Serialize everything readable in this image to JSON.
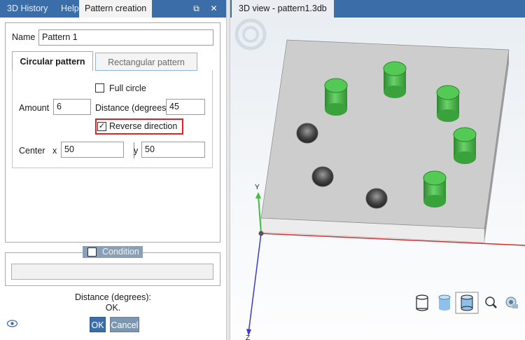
{
  "left_panel": {
    "tabs": [
      "3D History",
      "Help",
      "Pattern creation"
    ],
    "active_tab": "Pattern creation",
    "controls": {
      "pin": "⧉",
      "close": "✕"
    },
    "name_label": "Name",
    "name_value": "Pattern 1",
    "pattern_tabs": [
      "Circular pattern",
      "Rectangular pattern"
    ],
    "full_circle_label": "Full circle",
    "full_circle_checked": false,
    "amount_label": "Amount",
    "amount_value": "6",
    "distance_label": "Distance (degrees)",
    "distance_value": "45",
    "reverse_label": "Reverse direction",
    "reverse_checked": true,
    "center_label": "Center",
    "x_label": "x",
    "x_value": "50",
    "y_label": "y",
    "y_value": "50",
    "condition_label": "Condition",
    "condition_checked": false,
    "status_line1": "Distance (degrees):",
    "status_line2": "OK.",
    "ok_label": "OK",
    "cancel_label": "Cancel",
    "visibility_icon": "eye-icon"
  },
  "viewport": {
    "tab_title": "3D view - pattern1.3db",
    "axis_y_label": "Y",
    "axis_z_label": "Z",
    "toolbar_icons": [
      "wireframe-cylinder-icon",
      "shaded-cylinder-icon",
      "shaded-edges-cylinder-icon",
      "zoom-icon",
      "view-options-icon"
    ]
  },
  "colors": {
    "accent": "#3b6ea8",
    "highlight": "#e02020",
    "hole_green": "#2fae2f",
    "plate_gray": "#c9c9c9"
  }
}
